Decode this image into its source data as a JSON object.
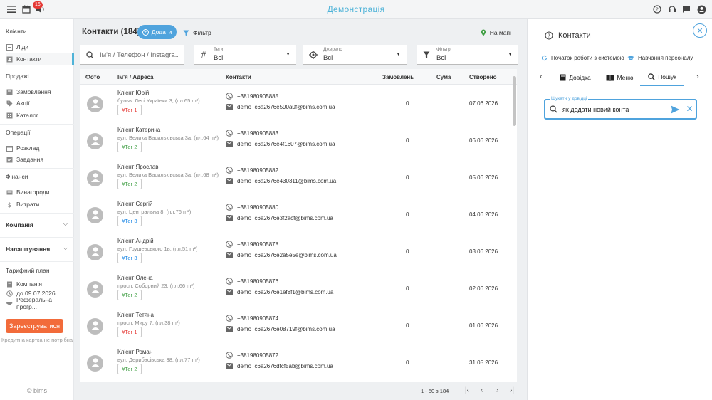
{
  "app": {
    "title": "Демонстрація",
    "notification_count": "16"
  },
  "sidebar": {
    "sections": {
      "clients": "Клієнти",
      "sales": "Продажі",
      "operations": "Операції",
      "finance": "Фінанси",
      "company": "Компанія",
      "settings": "Налаштування",
      "plan": "Тарифний план"
    },
    "items": {
      "leads": "Ліди",
      "contacts": "Контакти",
      "orders": "Замовлення",
      "promos": "Акції",
      "catalog": "Каталог",
      "schedule": "Розклад",
      "tasks": "Завдання",
      "rewards": "Винагороди",
      "expenses": "Витрати",
      "plan_company": "Компанія",
      "plan_until": "до 09.07.2026",
      "referral": "Реферальна прогр..."
    },
    "register_button": "Зареєструватися",
    "register_note": "Кредитна картка не потрібна",
    "copyright": "© bims"
  },
  "main": {
    "title": "Контакти (184)",
    "add_button": "Додати",
    "filter_link": "Фільтр",
    "map_link": "На мапі",
    "search_placeholder": "Ім'я / Телефон / Instagra...",
    "tags": {
      "label": "Теги",
      "value": "Всі"
    },
    "source": {
      "label": "Джерело",
      "value": "Всі"
    },
    "filter": {
      "label": "Фільтр",
      "value": "Всі"
    },
    "columns": {
      "photo": "Фото",
      "name_address": "Ім'я / Адреса",
      "contacts": "Контакти",
      "orders": "Замовлень",
      "sum": "Сума",
      "created": "Створено"
    },
    "rows": [
      {
        "name": "Клієнт Юрій",
        "address": "бульв. Лесі Українки 3, (пл.65 m²)",
        "tag": "#Тег 1",
        "tag_color": "#e53935",
        "phone": "+381980905885",
        "email": "demo_c6a2676e590a0f@bims.com.ua",
        "orders": "0",
        "created": "07.06.2026"
      },
      {
        "name": "Клієнт Катерина",
        "address": "вул. Велика Васильківська 3а, (пл.64 m²)",
        "tag": "#Тег 2",
        "tag_color": "#43a047",
        "phone": "+381980905883",
        "email": "demo_c6a2676e4f1607@bims.com.ua",
        "orders": "0",
        "created": "06.06.2026"
      },
      {
        "name": "Клієнт Ярослав",
        "address": "вул. Велика Васильківська 3а, (пл.68 m²)",
        "tag": "#Тег 2",
        "tag_color": "#43a047",
        "phone": "+381980905882",
        "email": "demo_c6a2676e430311@bims.com.ua",
        "orders": "0",
        "created": "05.06.2026"
      },
      {
        "name": "Клієнт Сергій",
        "address": "вул. Центральна 8, (пл.76 m²)",
        "tag": "#Тег 3",
        "tag_color": "#1e88e5",
        "phone": "+381980905880",
        "email": "demo_c6a2676e3f2acf@bims.com.ua",
        "orders": "0",
        "created": "04.06.2026"
      },
      {
        "name": "Клієнт Андрій",
        "address": "вул. Грушевського 1в, (пл.51 m²)",
        "tag": "#Тег 3",
        "tag_color": "#1e88e5",
        "phone": "+381980905878",
        "email": "demo_c6a2676e2a5e5e@bims.com.ua",
        "orders": "0",
        "created": "03.06.2026"
      },
      {
        "name": "Клієнт Олена",
        "address": "просп. Соборний 23, (пл.66 m²)",
        "tag": "#Тег 2",
        "tag_color": "#43a047",
        "phone": "+381980905876",
        "email": "demo_c6a2676e1ef8f1@bims.com.ua",
        "orders": "0",
        "created": "02.06.2026"
      },
      {
        "name": "Клієнт Тетяна",
        "address": "просп. Миру 7, (пл.38 m²)",
        "tag": "#Тег 1",
        "tag_color": "#e53935",
        "phone": "+381980905874",
        "email": "demo_c6a2676e08719f@bims.com.ua",
        "orders": "0",
        "created": "01.06.2026"
      },
      {
        "name": "Клієнт Роман",
        "address": "вул. Дерибасівська 38, (пл.77 m²)",
        "tag": "#Тег 2",
        "tag_color": "#43a047",
        "phone": "+381980905872",
        "email": "demo_c6a2676dfcf5ab@bims.com.ua",
        "orders": "0",
        "created": "31.05.2026"
      }
    ],
    "pagination": "1 - 50 з 184"
  },
  "panel": {
    "title": "Контакти",
    "link_start": "Початок роботи з системою",
    "link_training": "Навчання персоналу",
    "tabs": {
      "help": "Довідка",
      "menu": "Меню",
      "search": "Пошук"
    },
    "search_legend": "Шукати у довідці",
    "search_value": "як додати новий конта"
  },
  "colors": {
    "accent": "#4fa3dd",
    "title": "#4fb3d8",
    "register": "#f26b3a"
  }
}
